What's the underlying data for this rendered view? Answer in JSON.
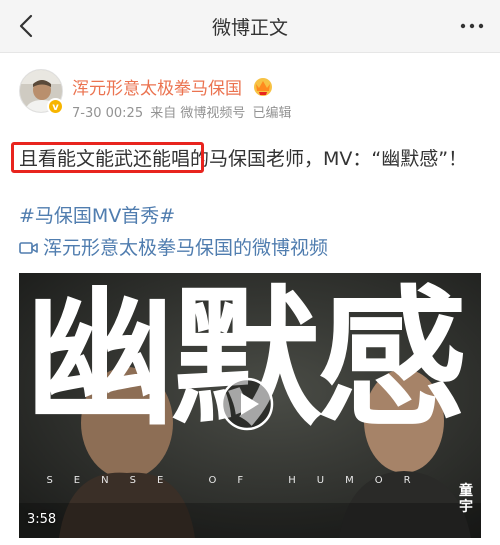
{
  "nav": {
    "title": "微博正文",
    "back_icon": "chevron-left-icon",
    "more_icon": "more-dots-icon"
  },
  "post": {
    "author": "浑元形意太极拳马保国",
    "time": "7-30 00:25",
    "source": "来自 微博视频号",
    "edited": "已编辑",
    "text_highlight": "且看能文能武还能唱",
    "text_rest": "的马保国老师，MV：“幽默感”！",
    "hashtag": "#马保国MV首秀#",
    "video_link": "浑元形意太极拳马保国的微博视频"
  },
  "video": {
    "title_chars": [
      "幽",
      "默",
      "感"
    ],
    "subtitle": "SENSE OF HUMOR",
    "side_credit": "童宇",
    "duration": "3:58"
  },
  "colors": {
    "author_name": "#eb7350",
    "link": "#507daf",
    "highlight_border": "#e8241e",
    "verified_badge": "#f7b500"
  }
}
